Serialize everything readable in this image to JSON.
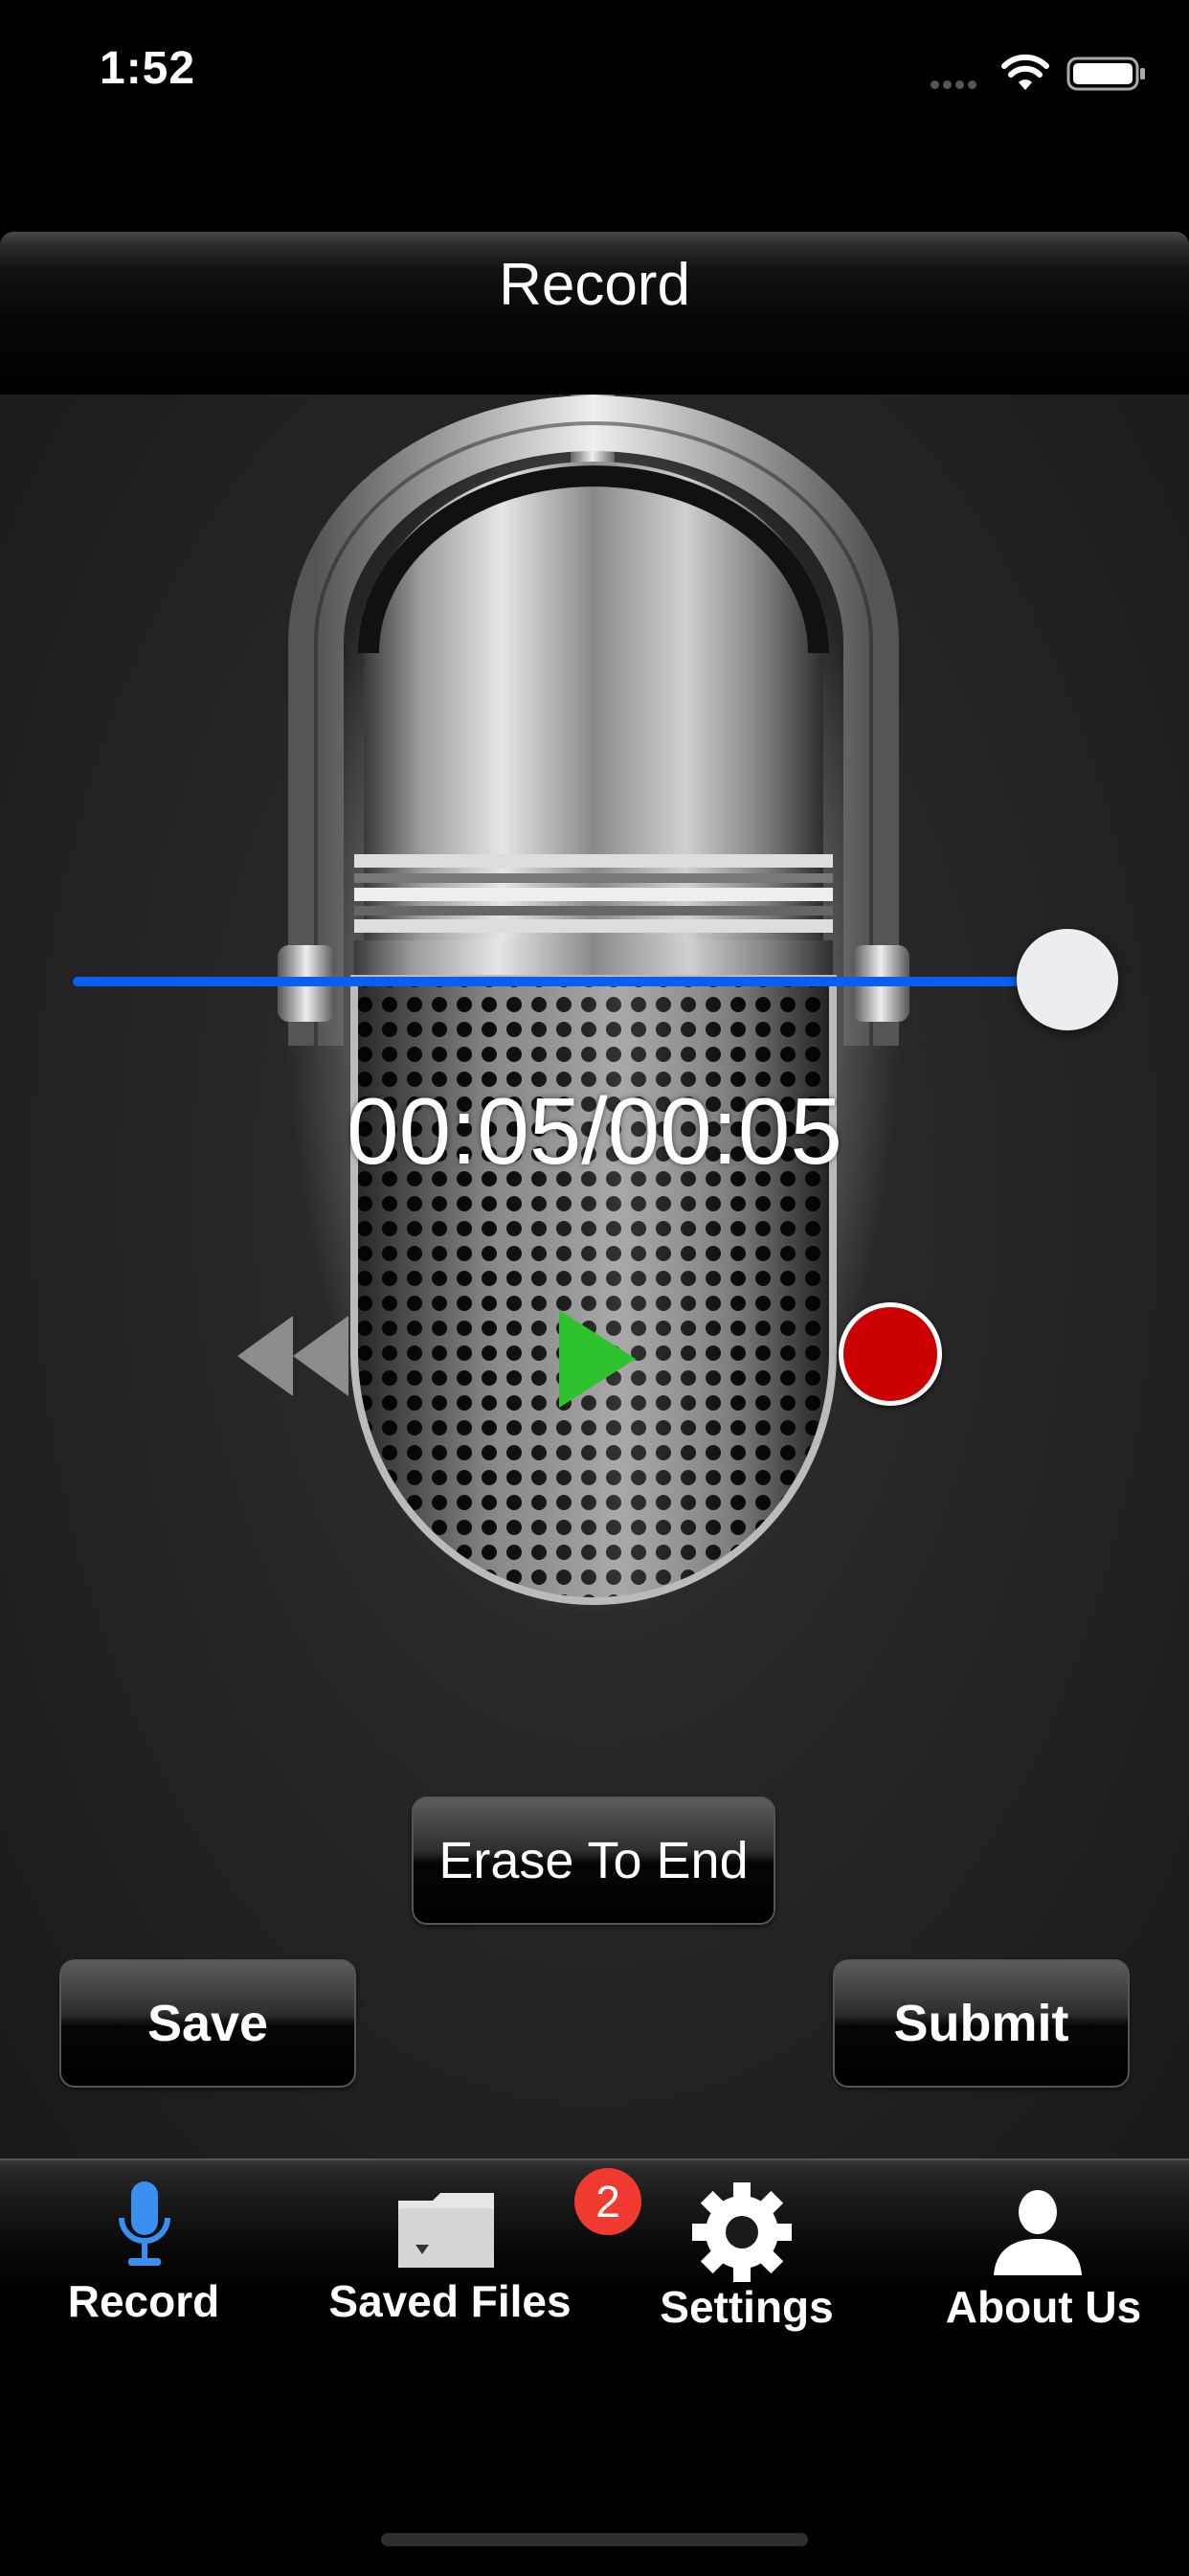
{
  "status_bar": {
    "time": "1:52",
    "icons": [
      "cellular-signal-icon",
      "wifi-icon",
      "battery-icon"
    ]
  },
  "header": {
    "title": "Record"
  },
  "player": {
    "time_readout": "00:05/00:05",
    "progress_fraction": 1.0,
    "controls": [
      "rewind-icon",
      "play-icon",
      "record-icon"
    ]
  },
  "actions": {
    "erase_label": "Erase To End",
    "save_label": "Save",
    "submit_label": "Submit"
  },
  "tab_bar": {
    "tabs": [
      {
        "label": "Record",
        "icon": "microphone-icon",
        "selected": true
      },
      {
        "label": "Saved Files",
        "icon": "folder-icon",
        "badge": "2"
      },
      {
        "label": "Settings",
        "icon": "gear-icon"
      },
      {
        "label": "About Us",
        "icon": "person-icon"
      }
    ]
  },
  "colors": {
    "accent_blue": "#0a5ef0",
    "play_green": "#2fc22f",
    "record_red": "#cc0000",
    "badge_red": "#f23b30",
    "selected_tab_icon": "#3a8ff0"
  }
}
